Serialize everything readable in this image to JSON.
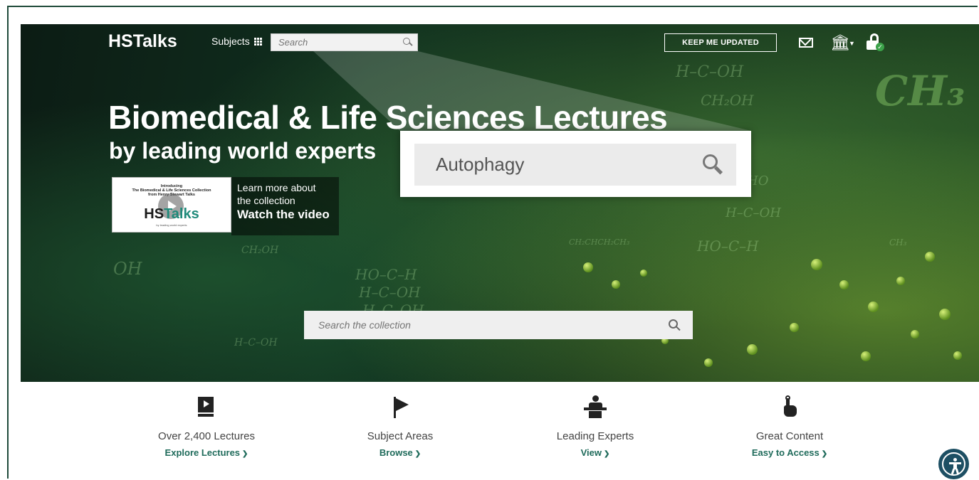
{
  "header": {
    "logo": "HSTalks",
    "subjects_label": "Subjects",
    "search_placeholder": "Search",
    "keep_updated_label": "KEEP ME UPDATED"
  },
  "hero": {
    "headline": "Biomedical & Life Sciences Lectures",
    "subheadline": "by leading world experts",
    "zoomed_search_value": "Autophagy",
    "video": {
      "thumb_intro": "Introducing",
      "thumb_line1": "The Biomedical & Life Sciences Collection",
      "thumb_line2": "from Henry Stewart Talks",
      "thumb_logo_a": "HS",
      "thumb_logo_b": "Talks",
      "thumb_tagline": "by leading world experts",
      "learn_more_line1": "Learn more about",
      "learn_more_line2": "the collection",
      "watch_label": "Watch the video"
    },
    "collection_search_placeholder": "Search the collection"
  },
  "features": [
    {
      "icon": "video-lecture-icon",
      "title": "Over 2,400 Lectures",
      "link": "Explore Lectures"
    },
    {
      "icon": "flag-icon",
      "title": "Subject Areas",
      "link": "Browse"
    },
    {
      "icon": "speaker-podium-icon",
      "title": "Leading Experts",
      "link": "View"
    },
    {
      "icon": "pointing-hand-icon",
      "title": "Great Content",
      "link": "Easy to Access"
    }
  ],
  "colors": {
    "accent_link": "#1f6b5b",
    "frame_border": "#1f4a3a",
    "accessibility_button": "#1d4f63"
  }
}
